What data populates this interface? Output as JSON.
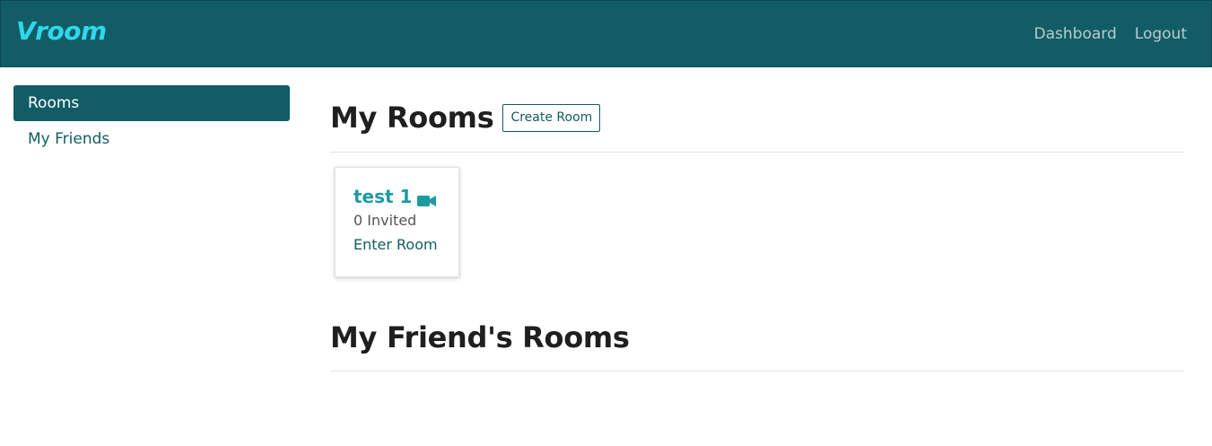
{
  "navbar": {
    "brand": "Vroom",
    "links": [
      "Dashboard",
      "Logout"
    ]
  },
  "sidebar": {
    "items": [
      {
        "label": "Rooms",
        "active": true
      },
      {
        "label": "My Friends",
        "active": false
      }
    ]
  },
  "main": {
    "my_rooms": {
      "title": "My Rooms",
      "create_label": "Create Room",
      "rooms": [
        {
          "name": "test 1",
          "icon": "video-camera-icon",
          "invited": "0 Invited",
          "action": "Enter Room"
        }
      ]
    },
    "friends_rooms": {
      "title": "My Friend's Rooms"
    }
  },
  "colors": {
    "primary": "#125c66",
    "brand": "#2fd8ea",
    "room_title": "#1e9aa3"
  }
}
